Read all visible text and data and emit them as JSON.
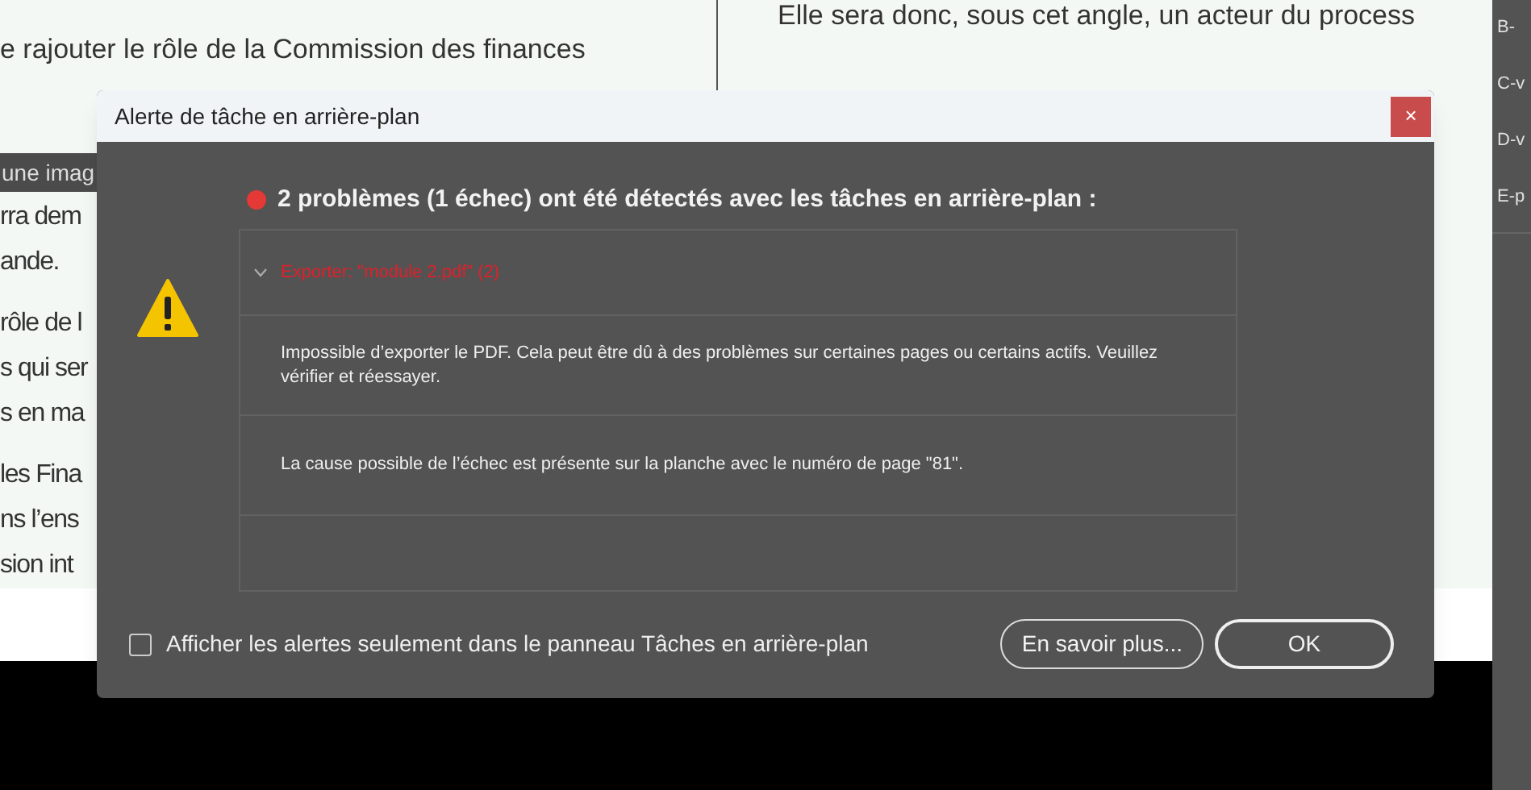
{
  "document": {
    "top_lines": [
      "e rajouter le rôle de la Commission des finances"
    ],
    "right_lines": [
      "Elle sera donc, sous cet angle, un acteur du process"
    ],
    "toolbar": {
      "text": "une imag"
    },
    "paragraphs": [
      [
        "rra dem",
        "ande."
      ],
      [
        "rôle de l",
        "s qui ser",
        "s en ma"
      ],
      [
        "les Fina",
        "ns l’ens",
        "sion int"
      ]
    ]
  },
  "side_panel": {
    "items": [
      "B-",
      "C-v",
      "D-v",
      "E-p"
    ]
  },
  "dialog": {
    "title": "Alerte de tâche en arrière-plan",
    "close": "×",
    "heading": "2 problèmes (1 échec) ont été détectés avec les tâches en arrière-plan :",
    "task": {
      "label": "Exporter: \"module 2.pdf\" (2)",
      "expanded": true
    },
    "messages": [
      "Impossible d’exporter le PDF. Cela peut être dû à des problèmes sur certaines pages ou certains actifs. Veuillez vérifier et réessayer.",
      "La cause possible de l’échec est présente sur la planche avec le numéro de page \"81\"."
    ],
    "checkbox": {
      "label": "Afficher les alertes seulement dans le panneau Tâches en arrière-plan",
      "checked": false
    },
    "buttons": [
      {
        "label": "En savoir plus...",
        "kind": "secondary"
      },
      {
        "label": "OK",
        "kind": "primary"
      }
    ]
  }
}
